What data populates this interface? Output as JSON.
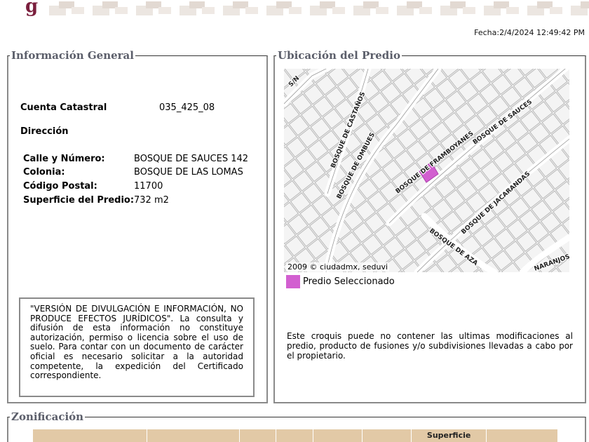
{
  "header": {
    "fecha": "Fecha:2/4/2024 12:49:42 PM"
  },
  "informacion_general": {
    "title": "Información General",
    "cuenta_label": "Cuenta Catastral",
    "cuenta_value": "035_425_08",
    "direccion_label": "Dirección",
    "fields": [
      {
        "label": "Calle y Número:",
        "value": "BOSQUE DE SAUCES 142"
      },
      {
        "label": "Colonia:",
        "value": "BOSQUE DE LAS LOMAS"
      },
      {
        "label": "Código Postal:",
        "value": "11700"
      },
      {
        "label": "Superficie del Predio:",
        "value": "732 m2"
      }
    ],
    "disclaimer": "\"VERSIÓN DE DIVULGACIÓN E INFORMACIÓN, NO PRODUCE EFECTOS JURÍDICOS\". La consulta y difusión de esta información no constituye autorización, permiso o licencia sobre el uso de suelo. Para contar con un documento de carácter oficial es necesario solicitar a la autoridad competente, la expedición del Certificado correspondiente."
  },
  "ubicacion": {
    "title": "Ubicación del Predio",
    "map_labels": {
      "sn": "S/N",
      "castanos": "BOSQUE DE CASTAÑOS",
      "ombues": "BOSQUE DE OMBUES",
      "framboyanes": "BOSQUE DE FRAMBOYANES",
      "sauces": "BOSQUE DE SAUCES",
      "jacarandas": "BOSQUE DE JACARANDAS",
      "azahares": "BOSQUE DE AZA",
      "naranjos": "NARANJOS"
    },
    "copyright": "2009 © ciudadmx, seduvi",
    "legend_label": "Predio Seleccionado",
    "legend_color": "#d25fd0",
    "note": "Este croquis puede no contener las ultimas modificaciones al predio, producto de fusiones y/o subdivisiones llevadas a cabo por el propietario."
  },
  "zonificacion": {
    "title": "Zonificación",
    "headers": [
      "",
      "",
      "",
      "",
      "",
      "",
      "Superficie",
      ""
    ]
  }
}
